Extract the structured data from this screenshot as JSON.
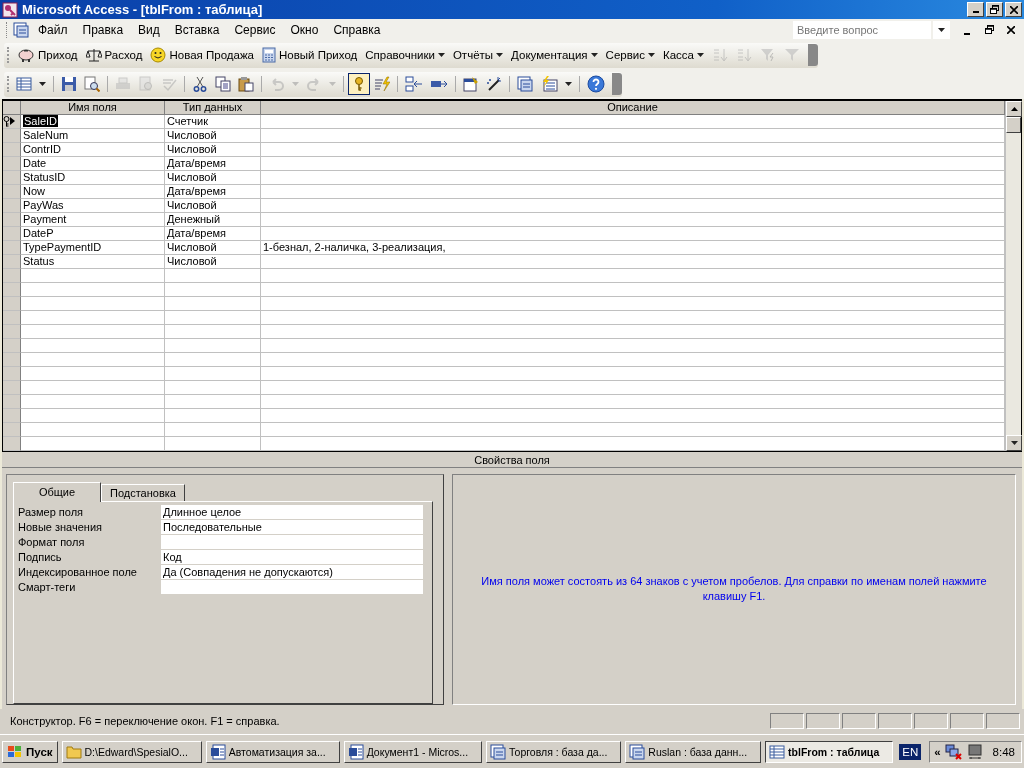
{
  "window": {
    "title": "Microsoft Access - [tblFrom : таблица]"
  },
  "menu": [
    "Файл",
    "Правка",
    "Вид",
    "Вставка",
    "Сервис",
    "Окно",
    "Справка"
  ],
  "help_search": {
    "placeholder": "Введите вопрос"
  },
  "custom_toolbar": [
    {
      "label": "Приход",
      "kind": "piggy"
    },
    {
      "label": "Расход",
      "kind": "scales"
    },
    {
      "label": "Новая Продажа",
      "kind": "smiley"
    },
    {
      "label": "Новый Приход",
      "kind": "calculator"
    },
    {
      "label": "Справочники",
      "kind": "menu"
    },
    {
      "label": "Отчёты",
      "kind": "menu"
    },
    {
      "label": "Документация",
      "kind": "menu"
    },
    {
      "label": "Сервис",
      "kind": "menu"
    },
    {
      "label": "Касса",
      "kind": "menu"
    },
    {
      "kind": "sortup",
      "disabled": true
    },
    {
      "kind": "sortdown",
      "disabled": true
    },
    {
      "kind": "filterbolt",
      "disabled": true
    },
    {
      "kind": "filter",
      "disabled": true
    }
  ],
  "design_toolbar": [
    {
      "kind": "table",
      "disabled": false,
      "pressed": false
    },
    {
      "kind": "caret",
      "disabled": false,
      "pressed": false
    },
    {
      "kind": "sep"
    },
    {
      "kind": "save",
      "disabled": false,
      "pressed": false
    },
    {
      "kind": "search",
      "disabled": false,
      "pressed": false
    },
    {
      "kind": "sep"
    },
    {
      "kind": "print",
      "disabled": true,
      "pressed": false
    },
    {
      "kind": "preview",
      "disabled": true,
      "pressed": false
    },
    {
      "kind": "spell",
      "disabled": true,
      "pressed": false
    },
    {
      "kind": "sep"
    },
    {
      "kind": "cut",
      "disabled": false,
      "pressed": false
    },
    {
      "kind": "copy",
      "disabled": false,
      "pressed": false
    },
    {
      "kind": "paste",
      "disabled": false,
      "pressed": false
    },
    {
      "kind": "sep"
    },
    {
      "kind": "undo",
      "disabled": true,
      "pressed": false
    },
    {
      "kind": "caret",
      "disabled": true,
      "pressed": false
    },
    {
      "kind": "redo",
      "disabled": true,
      "pressed": false
    },
    {
      "kind": "caret",
      "disabled": true,
      "pressed": false
    },
    {
      "kind": "sep"
    },
    {
      "kind": "key",
      "disabled": false,
      "pressed": true
    },
    {
      "kind": "bolt",
      "disabled": false,
      "pressed": false
    },
    {
      "kind": "sep"
    },
    {
      "kind": "insertrow",
      "disabled": false,
      "pressed": false
    },
    {
      "kind": "deleterow",
      "disabled": false,
      "pressed": false
    },
    {
      "kind": "sep"
    },
    {
      "kind": "props",
      "disabled": false,
      "pressed": false
    },
    {
      "kind": "wand",
      "disabled": false,
      "pressed": false
    },
    {
      "kind": "sep"
    },
    {
      "kind": "dbwindow",
      "disabled": false,
      "pressed": false
    },
    {
      "kind": "newobject",
      "disabled": false,
      "pressed": false
    },
    {
      "kind": "caret",
      "disabled": false,
      "pressed": false
    },
    {
      "kind": "sep"
    },
    {
      "kind": "help",
      "disabled": false,
      "pressed": false
    }
  ],
  "columns": [
    "Имя поля",
    "Тип данных",
    "Описание"
  ],
  "fields": [
    {
      "name": "SaleID",
      "type": "Счетчик",
      "primary_key": true,
      "selected": true
    },
    {
      "name": "SaleNum",
      "type": "Числовой",
      "primary_key": false,
      "selected": false
    },
    {
      "name": "ContrID",
      "type": "Числовой",
      "primary_key": false,
      "selected": false
    },
    {
      "name": "Date",
      "type": "Дата/время",
      "primary_key": false,
      "selected": false
    },
    {
      "name": "StatusID",
      "type": "Числовой",
      "primary_key": false,
      "selected": false
    },
    {
      "name": "Now",
      "type": "Дата/время",
      "primary_key": false,
      "selected": false
    },
    {
      "name": "PayWas",
      "type": "Числовой",
      "primary_key": false,
      "selected": false
    },
    {
      "name": "Payment",
      "type": "Денежный",
      "primary_key": false,
      "selected": false
    },
    {
      "name": "DateP",
      "type": "Дата/время",
      "primary_key": false,
      "selected": false
    },
    {
      "name": "TypePaymentID",
      "type": "Числовой",
      "description": "1-безнал, 2-наличка, 3-реализация,",
      "primary_key": false,
      "selected": false
    },
    {
      "name": "Status",
      "type": "Числовой",
      "primary_key": false,
      "selected": false
    }
  ],
  "field_properties_title": "Свойства поля",
  "tabs": [
    {
      "label": "Общие",
      "selected": true
    },
    {
      "label": "Подстановка",
      "selected": false
    }
  ],
  "properties": [
    {
      "label": "Размер поля",
      "value": "Длинное целое"
    },
    {
      "label": "Новые значения",
      "value": "Последовательные"
    },
    {
      "label": "Формат поля"
    },
    {
      "label": "Подпись",
      "value": "Код"
    },
    {
      "label": "Индексированное поле",
      "value": "Да (Совпадения не допускаются)"
    },
    {
      "label": "Смарт-теги"
    }
  ],
  "help_text": "Имя поля может состоять из 64 знаков с учетом пробелов.  Для справки по именам полей нажмите клавишу F1.",
  "status_bar": "Конструктор.  F6 = переключение окон.  F1 = справка.",
  "taskbar": {
    "start": "Пуск",
    "tasks": [
      {
        "label": "D:\\Edward\\SpesialO...",
        "kind": "folder",
        "selected": false
      },
      {
        "label": "Автоматизация за...",
        "kind": "word",
        "selected": false
      },
      {
        "label": "Документ1 - Micros...",
        "kind": "word",
        "selected": false
      },
      {
        "label": "Торговля : база да...",
        "kind": "database",
        "selected": false
      },
      {
        "label": "Ruslan : база данн...",
        "kind": "database",
        "selected": false
      },
      {
        "label": "tblFrom : таблица",
        "kind": "table",
        "selected": true
      }
    ],
    "language": "EN",
    "chevron": "«",
    "clock": "8:48"
  }
}
